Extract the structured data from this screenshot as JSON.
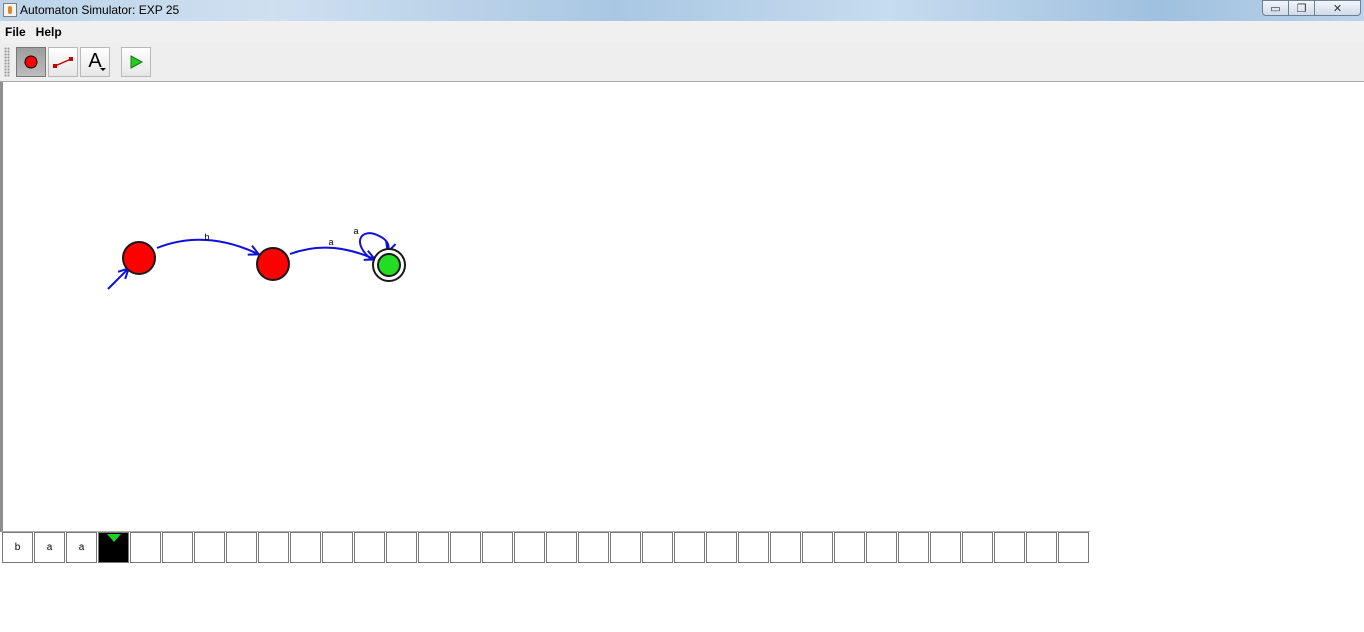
{
  "window": {
    "title": "Automaton Simulator: EXP 25",
    "controls": {
      "minimize": "▭",
      "maximize": "❐",
      "close": "✕"
    }
  },
  "menu": {
    "items": [
      "File",
      "Help"
    ]
  },
  "toolbar": {
    "tools": [
      {
        "name": "add-state",
        "icon": "red-circle-icon",
        "active": true
      },
      {
        "name": "add-transition",
        "icon": "arrow-line-icon",
        "active": false
      },
      {
        "name": "add-label",
        "icon": "text-A-icon",
        "label": "A",
        "active": false
      },
      {
        "name": "run",
        "icon": "play-icon",
        "active": false
      }
    ]
  },
  "automaton": {
    "states": [
      {
        "id": "q0",
        "initial": true,
        "accepting": false,
        "color": "#ff0000"
      },
      {
        "id": "q1",
        "initial": false,
        "accepting": false,
        "color": "#ff0000"
      },
      {
        "id": "q2",
        "initial": false,
        "accepting": true,
        "color": "#22dd22"
      }
    ],
    "transitions": [
      {
        "from": "q0",
        "to": "q1",
        "label": "b"
      },
      {
        "from": "q1",
        "to": "q2",
        "label": "a"
      },
      {
        "from": "q2",
        "to": "q2",
        "label": "a"
      }
    ],
    "edge_color": "#1010dd"
  },
  "tape": {
    "cells": [
      "b",
      "a",
      "a",
      "",
      "",
      "",
      "",
      "",
      "",
      "",
      "",
      "",
      "",
      "",
      "",
      "",
      "",
      "",
      "",
      "",
      "",
      "",
      "",
      "",
      "",
      "",
      "",
      "",
      "",
      "",
      "",
      "",
      "",
      ""
    ],
    "head_index": 3,
    "head_color": "#1fd11f"
  }
}
